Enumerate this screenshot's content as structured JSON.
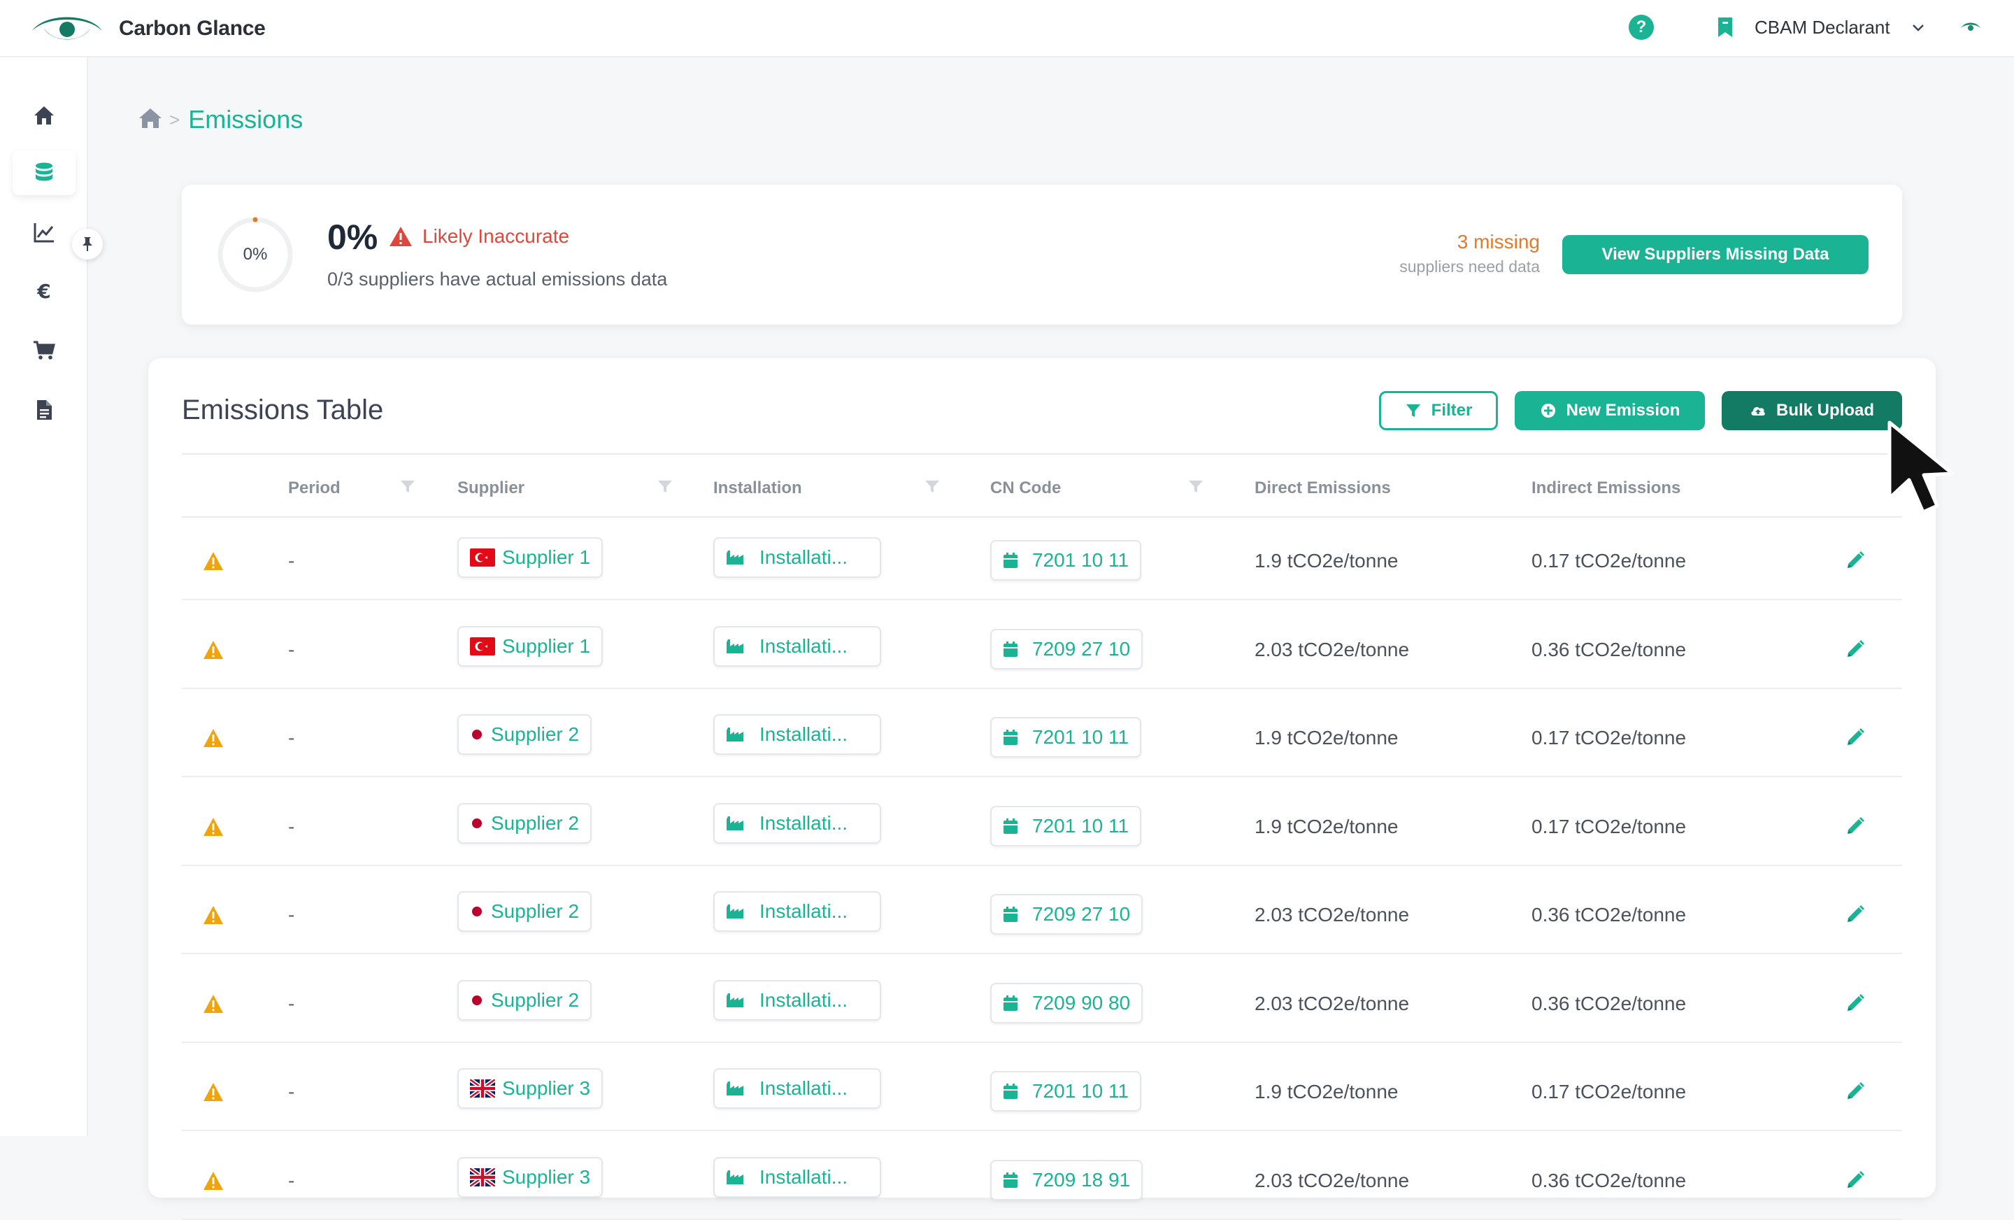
{
  "app": {
    "name": "Carbon Glance"
  },
  "header": {
    "role": "CBAM Declarant"
  },
  "breadcrumb": {
    "current": "Emissions"
  },
  "summary": {
    "ring_label": "0%",
    "percent": "0%",
    "status": "Likely Inaccurate",
    "subtitle": "0/3 suppliers have actual emissions data",
    "missing_count": "3 missing",
    "missing_sub": "suppliers need data",
    "cta": "View Suppliers Missing Data"
  },
  "table": {
    "title": "Emissions Table",
    "buttons": {
      "filter": "Filter",
      "new": "New Emission",
      "bulk": "Bulk Upload"
    },
    "columns": {
      "period": "Period",
      "supplier": "Supplier",
      "installation": "Installation",
      "cn_code": "CN Code",
      "direct": "Direct Emissions",
      "indirect": "Indirect Emissions"
    },
    "rows": [
      {
        "period": "-",
        "flag": "tr",
        "supplier": "Supplier 1",
        "installation": "Installati...",
        "cn": "7201 10 11",
        "direct": "1.9 tCO2e/tonne",
        "indirect": "0.17 tCO2e/tonne"
      },
      {
        "period": "-",
        "flag": "tr",
        "supplier": "Supplier 1",
        "installation": "Installati...",
        "cn": "7209 27 10",
        "direct": "2.03 tCO2e/tonne",
        "indirect": "0.36 tCO2e/tonne"
      },
      {
        "period": "-",
        "flag": "jp",
        "supplier": "Supplier 2",
        "installation": "Installati...",
        "cn": "7201 10 11",
        "direct": "1.9 tCO2e/tonne",
        "indirect": "0.17 tCO2e/tonne"
      },
      {
        "period": "-",
        "flag": "jp",
        "supplier": "Supplier 2",
        "installation": "Installati...",
        "cn": "7201 10 11",
        "direct": "1.9 tCO2e/tonne",
        "indirect": "0.17 tCO2e/tonne"
      },
      {
        "period": "-",
        "flag": "jp",
        "supplier": "Supplier 2",
        "installation": "Installati...",
        "cn": "7209 27 10",
        "direct": "2.03 tCO2e/tonne",
        "indirect": "0.36 tCO2e/tonne"
      },
      {
        "period": "-",
        "flag": "jp",
        "supplier": "Supplier 2",
        "installation": "Installati...",
        "cn": "7209 90 80",
        "direct": "2.03 tCO2e/tonne",
        "indirect": "0.36 tCO2e/tonne"
      },
      {
        "period": "-",
        "flag": "gb",
        "supplier": "Supplier 3",
        "installation": "Installati...",
        "cn": "7201 10 11",
        "direct": "1.9 tCO2e/tonne",
        "indirect": "0.17 tCO2e/tonne"
      },
      {
        "period": "-",
        "flag": "gb",
        "supplier": "Supplier 3",
        "installation": "Installati...",
        "cn": "7209 18 91",
        "direct": "2.03 tCO2e/tonne",
        "indirect": "0.36 tCO2e/tonne"
      }
    ]
  },
  "colors": {
    "accent": "#1ab394",
    "accent_dark": "#137a63",
    "warning": "#f0a30a",
    "danger": "#e0473c",
    "missing": "#e07a2c"
  },
  "icons": {
    "sidebar": [
      "home-icon",
      "database-icon",
      "chart-line-icon",
      "euro-icon",
      "cart-icon",
      "document-icon"
    ]
  }
}
